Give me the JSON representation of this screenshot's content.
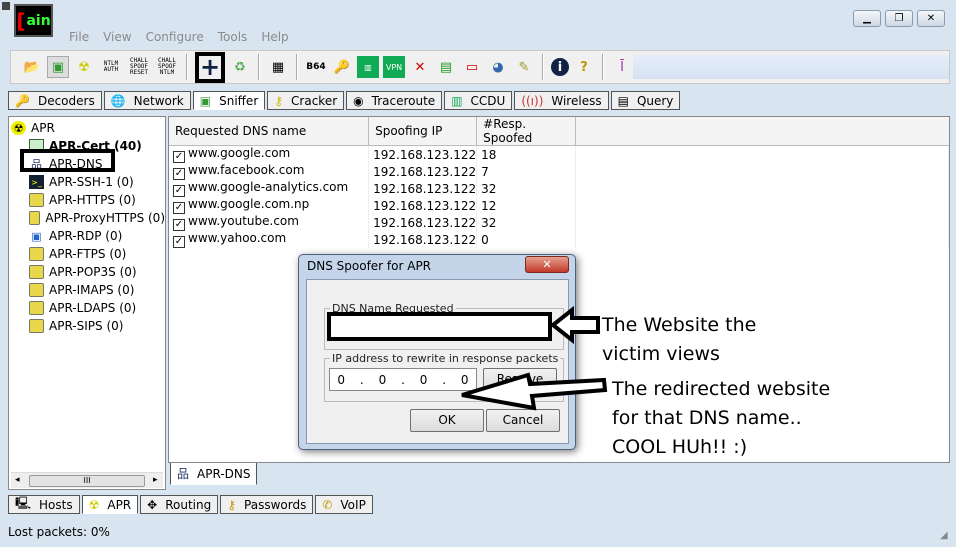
{
  "app": {
    "logo_text": "Cain"
  },
  "window_controls": [
    "minimize",
    "restore",
    "close"
  ],
  "menu": [
    "File",
    "View",
    "Configure",
    "Tools",
    "Help"
  ],
  "toolbar": {
    "labels": {
      "ntlm_auth": "NTLM AUTH",
      "chall_spoof_reset": "CHALL SPOOF RESET",
      "chall_spoof_ntlm": "CHALL SPOOF NTLM",
      "base64": "B64"
    }
  },
  "tabs": [
    "Decoders",
    "Network",
    "Sniffer",
    "Cracker",
    "Traceroute",
    "CCDU",
    "Wireless",
    "Query"
  ],
  "active_tab": "Sniffer",
  "tree": {
    "root": "APR",
    "items": [
      "APR-Cert (40)",
      "APR-DNS",
      "APR-SSH-1 (0)",
      "APR-HTTPS (0)",
      "APR-ProxyHTTPS (0)",
      "APR-RDP (0)",
      "APR-FTPS (0)",
      "APR-POP3S (0)",
      "APR-IMAPS (0)",
      "APR-LDAPS (0)",
      "APR-SIPS (0)"
    ]
  },
  "table": {
    "columns": [
      "Requested DNS name",
      "Spoofing IP",
      "#Resp. Spoofed"
    ],
    "rows": [
      {
        "name": "www.google.com",
        "ip": "192.168.123.122",
        "count": "18",
        "checked": true
      },
      {
        "name": "www.facebook.com",
        "ip": "192.168.123.122",
        "count": "7",
        "checked": true
      },
      {
        "name": "www.google-analytics.com",
        "ip": "192.168.123.122",
        "count": "32",
        "checked": true
      },
      {
        "name": "www.google.com.np",
        "ip": "192.168.123.122",
        "count": "12",
        "checked": true
      },
      {
        "name": "www.youtube.com",
        "ip": "192.168.123.122",
        "count": "32",
        "checked": true
      },
      {
        "name": "www.yahoo.com",
        "ip": "192.168.123.122",
        "count": "0",
        "checked": true
      }
    ]
  },
  "subtab": "APR-DNS",
  "bottom_tabs": [
    "Hosts",
    "APR",
    "Routing",
    "Passwords",
    "VoIP"
  ],
  "status": "Lost packets:  0%",
  "dialog": {
    "title": "DNS Spoofer for APR",
    "dns_legend": "DNS Name Requested",
    "dns_value": "",
    "ip_legend": "IP address to rewrite in response packets",
    "ip_octets": [
      "0",
      "0",
      "0",
      "0"
    ],
    "resolve": "Resolve",
    "ok": "OK",
    "cancel": "Cancel"
  },
  "annotations": {
    "a1": [
      "The Website the",
      "victim views"
    ],
    "a2": [
      "The redirected website",
      "for that DNS name..",
      "COOL HUh!! :)"
    ]
  }
}
